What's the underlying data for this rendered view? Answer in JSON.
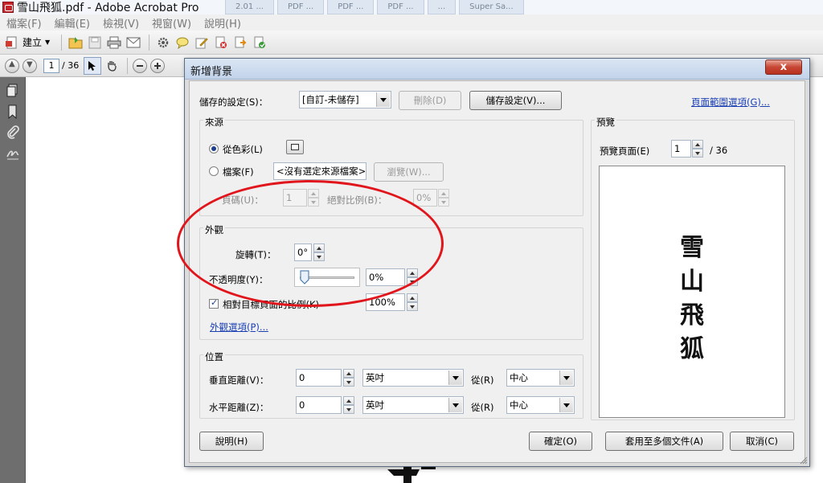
{
  "app": {
    "title": "雪山飛狐.pdf - Adobe Acrobat Pro",
    "background_tabs": [
      "2.01 ...",
      "PDF ...",
      "PDF ...",
      "PDF ...",
      "...",
      "Super Sa..."
    ]
  },
  "menu": [
    "檔案(F)",
    "編輯(E)",
    "檢視(V)",
    "視窗(W)",
    "說明(H)"
  ],
  "toolbar": {
    "create_label": "建立"
  },
  "nav": {
    "page_current": "1",
    "page_total": "/ 36"
  },
  "dialog": {
    "title": "新增背景",
    "close_glyph": "x",
    "saved_settings_label": "儲存的設定(S)：",
    "saved_settings_value": "[自訂-未儲存]",
    "delete_button": "刪除(D)",
    "save_settings_button": "儲存設定(V)...",
    "page_range_link": "頁面範圍選項(G)...",
    "source": {
      "title": "來源",
      "from_color_label": "從色彩(L)",
      "file_label": "檔案(F)",
      "file_value": "<沒有選定來源檔案>",
      "browse_button": "瀏覽(W)...",
      "page_number_label": "頁碼(U)：",
      "page_number_value": "1",
      "absolute_scale_label": "絕對比例(B)：",
      "absolute_scale_value": "0%"
    },
    "appearance": {
      "title": "外觀",
      "rotation_label": "旋轉(T)：",
      "rotation_value": "0°",
      "opacity_label": "不透明度(Y)：",
      "opacity_value": "0%",
      "opacity_fraction": 0,
      "relative_scale_label": "相對目標頁面的比例(K)",
      "relative_scale_value": "100%",
      "appearance_options_link": "外觀選項(P)..."
    },
    "position": {
      "title": "位置",
      "vertical_label": "垂直距離(V)：",
      "vertical_value": "0",
      "vertical_unit": "英吋",
      "vertical_from_label": "從(R)",
      "vertical_from_value": "中心",
      "horizontal_label": "水平距離(Z)：",
      "horizontal_value": "0",
      "horizontal_unit": "英吋",
      "horizontal_from_label": "從(R)",
      "horizontal_from_value": "中心"
    },
    "preview": {
      "title": "預覽",
      "page_label": "預覽頁面(E)",
      "page_value": "1",
      "page_total": "/ 36",
      "text_chars": [
        "雪",
        "山",
        "飛",
        "狐"
      ]
    },
    "buttons": {
      "help": "說明(H)",
      "ok": "確定(O)",
      "apply_multiple": "套用至多個文件(A)",
      "cancel": "取消(C)"
    }
  },
  "colors": {
    "annotation": "#e0161c",
    "link": "#1a3fb3",
    "close_button": "#c74634"
  }
}
